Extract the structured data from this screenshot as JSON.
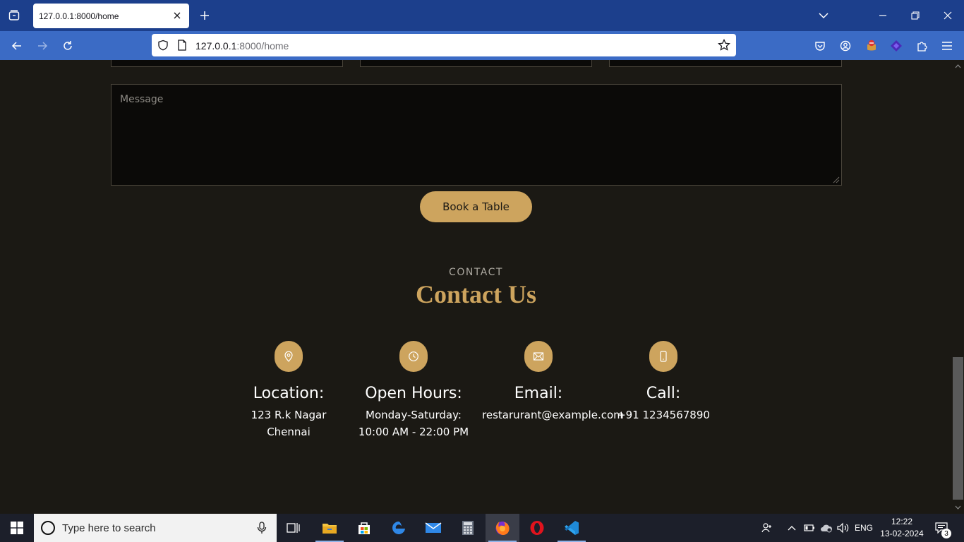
{
  "browser": {
    "tab": {
      "title": "127.0.0.1:8000/home"
    },
    "url": {
      "host": "127.0.0.1",
      "rest": ":8000/home"
    }
  },
  "booking": {
    "message_placeholder": "Message",
    "book_button": "Book a Table"
  },
  "contact": {
    "kicker": "CONTACT",
    "title": "Contact Us",
    "items": [
      {
        "icon": "map-pin-icon",
        "heading": "Location:",
        "lines": [
          "123 R.k Nagar",
          "Chennai"
        ]
      },
      {
        "icon": "clock-icon",
        "heading": "Open Hours:",
        "lines": [
          "Monday-Saturday:",
          "10:00 AM - 22:00 PM"
        ]
      },
      {
        "icon": "envelope-icon",
        "heading": "Email:",
        "lines": [
          "restarurant@example.com"
        ]
      },
      {
        "icon": "phone-icon",
        "heading": "Call:",
        "lines": [
          "+91 1234567890"
        ]
      }
    ]
  },
  "taskbar": {
    "search_placeholder": "Type here to search",
    "language": "ENG",
    "time": "12:22",
    "date": "13-02-2024",
    "notification_count": "3"
  },
  "colors": {
    "accent": "#cda45e",
    "page_bg": "#1b1914",
    "tabbar_bg": "#1c3f8c",
    "navbar_bg": "#3b6bc5"
  }
}
